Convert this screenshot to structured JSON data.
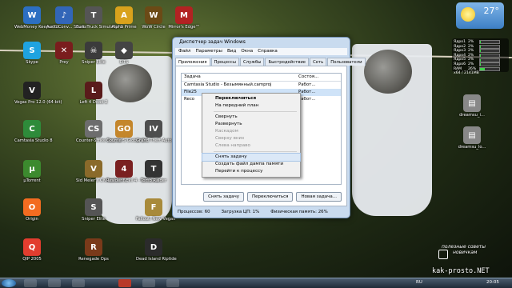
{
  "desktop": {
    "icons": [
      {
        "label": "WebMoney Keeper Cl...",
        "icon": "webmoney-icon",
        "color": "#2c6fc2",
        "glyph": "W"
      },
      {
        "label": "AudioConv... Studio",
        "icon": "audioconverter-icon",
        "color": "#3266b8",
        "glyph": "♪"
      },
      {
        "label": "Euro Truck Simulator 2",
        "icon": "truck-icon",
        "color": "#555",
        "glyph": "T"
      },
      {
        "label": "Alpha Prime",
        "icon": "alpha-prime-icon",
        "color": "#d9a21c",
        "glyph": "A"
      },
      {
        "label": "WoW Circle",
        "icon": "wow-icon",
        "color": "#6b4a16",
        "glyph": "W"
      },
      {
        "label": "Mirror's Edge™",
        "icon": "mirrors-edge-icon",
        "color": "#b22222",
        "glyph": "M"
      },
      {
        "label": "Skype",
        "icon": "skype-icon",
        "color": "#1fa3e0",
        "glyph": "S"
      },
      {
        "label": "Prey",
        "icon": "prey-icon",
        "color": "#7a1d1d",
        "glyph": "✕"
      },
      {
        "label": "Sniper Elite",
        "icon": "sniper-elite-icon",
        "color": "#3b3b3b",
        "glyph": "☠"
      },
      {
        "label": "DTS",
        "icon": "dts-icon",
        "color": "#444",
        "glyph": "◆"
      },
      {
        "label": "Vegas Pro 12.0 (64-bit)",
        "icon": "vegas-pro-icon",
        "color": "#222",
        "glyph": "V"
      },
      {
        "label": "Left 4 Dead 2",
        "icon": "left4dead-icon",
        "color": "#5a1b1b",
        "glyph": "L"
      },
      {
        "label": "Camtasia Studio 8",
        "icon": "camtasia-icon",
        "color": "#2e8b3a",
        "glyph": "C"
      },
      {
        "label": "Counter-Strike Source",
        "icon": "counter-strike-icon",
        "color": "#6d6d6d",
        "glyph": "CS"
      },
      {
        "label": "CounterS Global Of...",
        "icon": "csgo-icon",
        "color": "#c4862b",
        "glyph": "GO"
      },
      {
        "label": "Grand Theft Auto IV",
        "icon": "gta-icon",
        "color": "#4e4e4e",
        "glyph": "IV"
      },
      {
        "label": "µTorrent",
        "icon": "utorrent-icon",
        "color": "#3c8a2e",
        "glyph": "µ"
      },
      {
        "label": "Sid Meier's Civilization V",
        "icon": "civilization-icon",
        "color": "#8a6a2a",
        "glyph": "V"
      },
      {
        "label": "Resident Evil 4 - Ultimate...",
        "icon": "resident-evil-icon",
        "color": "#7a2020",
        "glyph": "4"
      },
      {
        "label": "Tomb Raider",
        "icon": "tomb-raider-icon",
        "color": "#333",
        "glyph": "T"
      },
      {
        "label": "Origin",
        "icon": "origin-icon",
        "color": "#f36c21",
        "glyph": "O"
      },
      {
        "label": "Sniper Elite",
        "icon": "sniper-elite-2-icon",
        "color": "#555",
        "glyph": "S"
      },
      {
        "label": "Fallout: New Vegas",
        "icon": "fallout-icon",
        "color": "#a88a3a",
        "glyph": "F"
      },
      {
        "label": "QIP 2005",
        "icon": "qip-icon",
        "color": "#e23d2f",
        "glyph": "Q"
      },
      {
        "label": "Renegade Ops",
        "icon": "renegade-ops-icon",
        "color": "#7a3a1a",
        "glyph": "R"
      },
      {
        "label": "Dead Island Riptide",
        "icon": "dead-island-icon",
        "color": "#2b2b2b",
        "glyph": "D"
      },
      {
        "label": "dreamsu_i...",
        "icon": "file-icon",
        "color": "#888",
        "glyph": "▤"
      },
      {
        "label": "dreamsu_lo...",
        "icon": "file-icon",
        "color": "#888",
        "glyph": "▤"
      }
    ]
  },
  "task_manager": {
    "title": "Диспетчер задач Windows",
    "menu": [
      "Файл",
      "Параметры",
      "Вид",
      "Окна",
      "Справка"
    ],
    "tabs": [
      "Приложения",
      "Процессы",
      "Службы",
      "Быстродействие",
      "Сеть",
      "Пользователи"
    ],
    "columns": {
      "task": "Задача",
      "status": "Состоя..."
    },
    "rows": [
      {
        "task": "Camtasia Studio - Безымянный.camproj",
        "status": "Работ..."
      },
      {
        "task": "File25",
        "status": "Работ..."
      },
      {
        "task": "Reco",
        "status": "Работ..."
      }
    ],
    "buttons": {
      "end_task": "Снять задачу",
      "switch_to": "Переключиться",
      "new_task": "Новая задача..."
    },
    "status": {
      "processes": "Процессов: 60",
      "cpu": "Загрузка ЦП: 1%",
      "memory": "Физическая память: 26%"
    }
  },
  "context_menu": [
    {
      "label": "Переключиться",
      "type": "bold"
    },
    {
      "label": "На передний план",
      "type": "normal"
    },
    {
      "type": "separator"
    },
    {
      "label": "Свернуть",
      "type": "normal"
    },
    {
      "label": "Развернуть",
      "type": "normal"
    },
    {
      "label": "Каскадом",
      "type": "disabled"
    },
    {
      "label": "Сверху вниз",
      "type": "disabled"
    },
    {
      "label": "Слева направо",
      "type": "disabled"
    },
    {
      "type": "separator"
    },
    {
      "label": "Снять задачу",
      "type": "highlight"
    },
    {
      "label": "Создать файл дампа памяти",
      "type": "normal"
    },
    {
      "label": "Перейти к процессу",
      "type": "normal"
    }
  ],
  "weather": {
    "temperature": "27°"
  },
  "meters": [
    {
      "label": "Ядро1",
      "value": "2%"
    },
    {
      "label": "Ядро2",
      "value": "2%"
    },
    {
      "label": "Ядро3",
      "value": "2%"
    },
    {
      "label": "Ядро4",
      "value": "2%"
    },
    {
      "label": "Ядро5",
      "value": "2%"
    },
    {
      "label": "Ядро6",
      "value": "2%"
    },
    {
      "label": "RAM",
      "value": "26%"
    }
  ],
  "meter_footer": "x64 / 2141MB",
  "watermark": {
    "line1": "полезные советы",
    "line2": "новичкам",
    "site": "kak-prosto.NET"
  },
  "taskbar": {
    "lang": "RU",
    "time": "20:05"
  }
}
